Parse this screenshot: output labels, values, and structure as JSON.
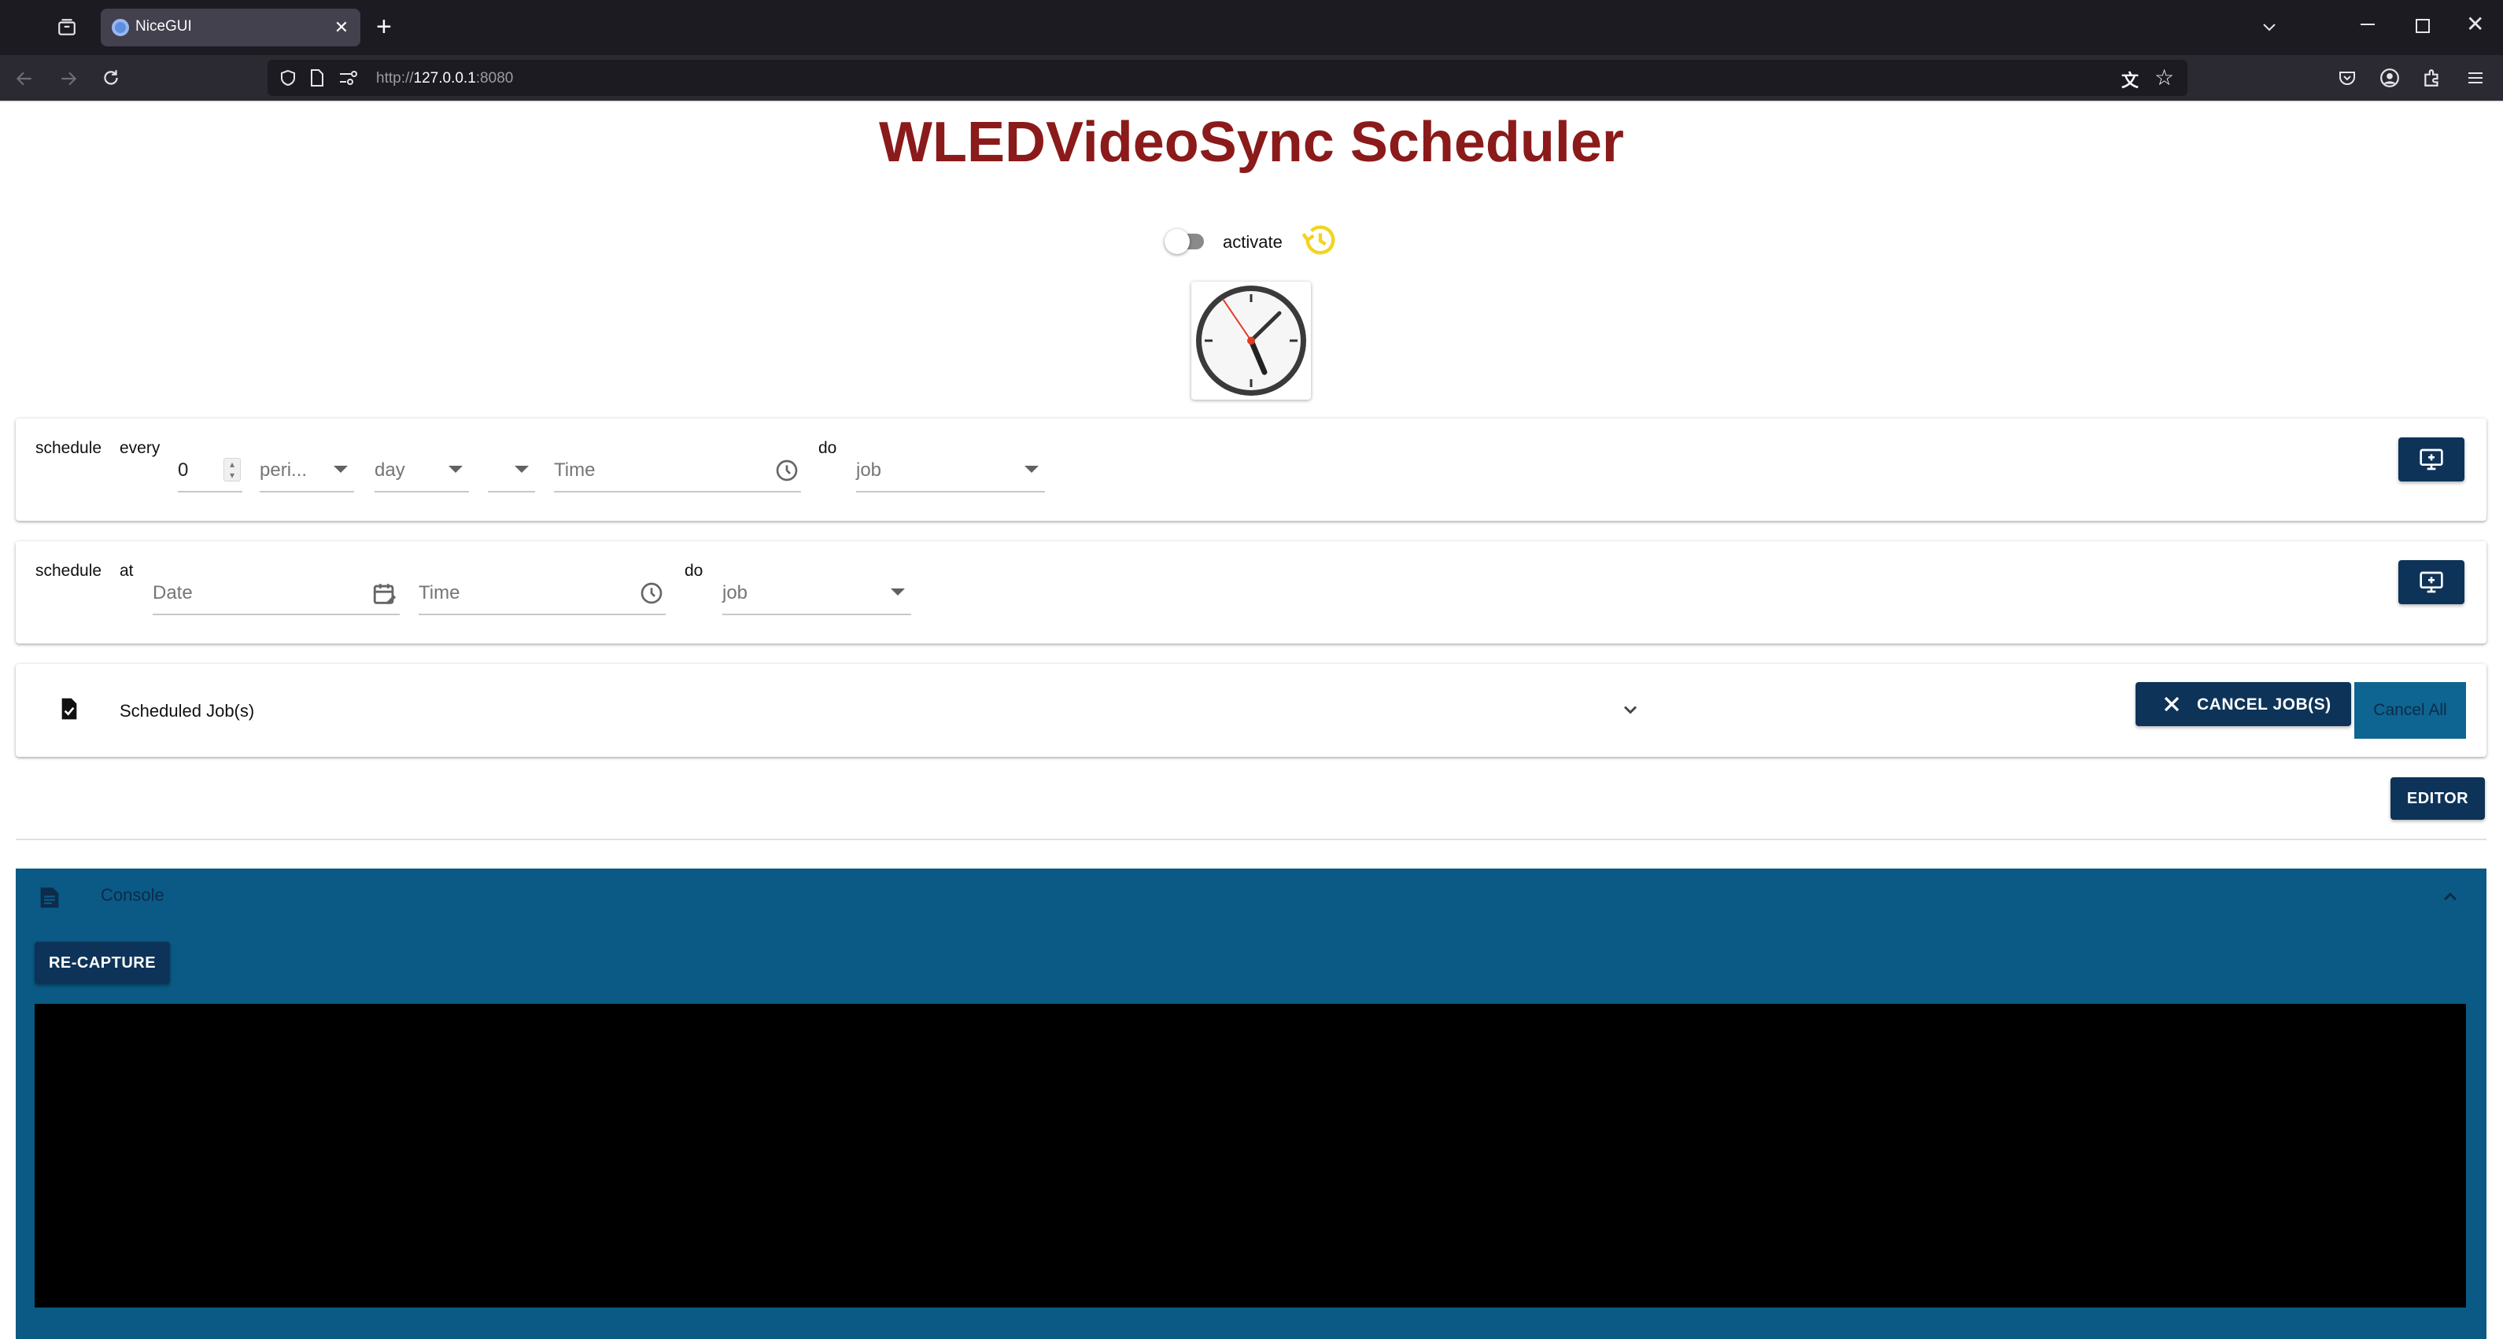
{
  "browser": {
    "tab_title": "NiceGUI",
    "url_prefix": "http://",
    "url_host": "127.0.0.1",
    "url_port": ":8080"
  },
  "page": {
    "title": "WLEDVideoSync Scheduler",
    "activate_label": "activate",
    "activate_on": false
  },
  "schedule_every": {
    "label_schedule": "schedule",
    "label_every": "every",
    "count_value": "0",
    "period_placeholder": "peri...",
    "unit_value": "day",
    "time_placeholder": "Time",
    "label_do": "do",
    "job_placeholder": "job"
  },
  "schedule_at": {
    "label_schedule": "schedule",
    "label_at": "at",
    "date_placeholder": "Date",
    "time_placeholder": "Time",
    "label_do": "do",
    "job_placeholder": "job"
  },
  "jobs": {
    "title": "Scheduled Job(s)",
    "cancel_jobs_label": "CANCEL JOB(S)",
    "cancel_all_label": "Cancel All"
  },
  "editor": {
    "label": "EDITOR"
  },
  "console": {
    "title": "Console",
    "recapture_label": "RE-CAPTURE"
  },
  "colors": {
    "title": "#8b1a1a",
    "button": "#0d3359",
    "console_bg": "#0a5a85",
    "history_icon": "#f2d41c"
  }
}
